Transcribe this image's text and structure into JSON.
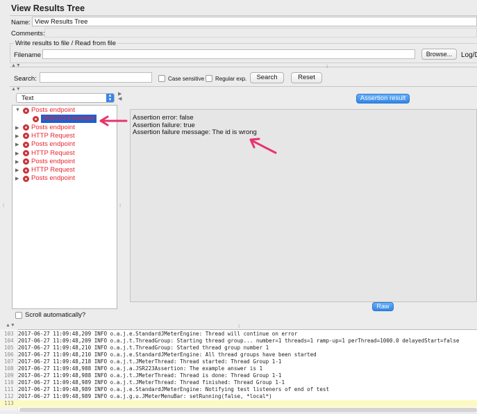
{
  "title": "View Results Tree",
  "name": {
    "label": "Name:",
    "value": "View Results Tree"
  },
  "comments": {
    "label": "Comments:",
    "value": ""
  },
  "file_group": {
    "title": "Write results to file / Read from file",
    "filename_label": "Filename",
    "filename_value": "",
    "browse_label": "Browse...",
    "log_label": "Log/D"
  },
  "search": {
    "label": "Search:",
    "value": "",
    "case_sensitive": "Case sensitive",
    "regular_exp": "Regular exp.",
    "search_btn": "Search",
    "reset_btn": "Reset"
  },
  "renderer": {
    "selected": "Text"
  },
  "tree": {
    "items": [
      {
        "label": "Posts endpoint",
        "expanded": true
      },
      {
        "label": "JSR223 Assertion",
        "child": true,
        "selected": true
      },
      {
        "label": "Posts endpoint"
      },
      {
        "label": "HTTP Request"
      },
      {
        "label": "Posts endpoint"
      },
      {
        "label": "HTTP Request"
      },
      {
        "label": "Posts endpoint"
      },
      {
        "label": "HTTP Request"
      },
      {
        "label": "Posts endpoint"
      }
    ],
    "scroll_auto": "Scroll automatically?"
  },
  "result": {
    "tab": "Assertion result",
    "lines": [
      "Assertion error: false",
      "Assertion failure: true",
      "Assertion failure message: The id is wrong"
    ],
    "raw_btn": "Raw"
  },
  "log": [
    {
      "n": "103",
      "text": "2017-06-27 11:09:48,209 INFO o.a.j.e.StandardJMeterEngine: Thread will continue on error"
    },
    {
      "n": "104",
      "text": "2017-06-27 11:09:48,209 INFO o.a.j.t.ThreadGroup: Starting thread group... number=1 threads=1 ramp-up=1 perThread=1000.0 delayedStart=false"
    },
    {
      "n": "105",
      "text": "2017-06-27 11:09:48,210 INFO o.a.j.t.ThreadGroup: Started thread group number 1"
    },
    {
      "n": "106",
      "text": "2017-06-27 11:09:48,210 INFO o.a.j.e.StandardJMeterEngine: All thread groups have been started"
    },
    {
      "n": "107",
      "text": "2017-06-27 11:09:48,218 INFO o.a.j.t.JMeterThread: Thread started: Thread Group 1-1"
    },
    {
      "n": "108",
      "text": "2017-06-27 11:09:48,988 INFO o.a.j.a.JSR223Assertion: The example answer is 1"
    },
    {
      "n": "109",
      "text": "2017-06-27 11:09:48,988 INFO o.a.j.t.JMeterThread: Thread is done: Thread Group 1-1"
    },
    {
      "n": "110",
      "text": "2017-06-27 11:09:48,989 INFO o.a.j.t.JMeterThread: Thread finished: Thread Group 1-1"
    },
    {
      "n": "111",
      "text": "2017-06-27 11:09:48,989 INFO o.a.j.e.StandardJMeterEngine: Notifying test listeners of end of test"
    },
    {
      "n": "112",
      "text": "2017-06-27 11:09:48,989 INFO o.a.j.g.u.JMeterMenuBar: setRunning(false, *local*)"
    },
    {
      "n": "113",
      "text": ""
    }
  ],
  "colors": {
    "accent_arrow": "#e8336b",
    "error_red": "#e8262e",
    "selection": "#1f5fd0",
    "button_blue": "#2f86e8"
  }
}
